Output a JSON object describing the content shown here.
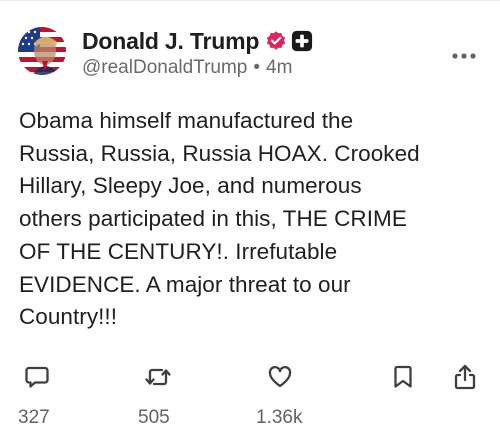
{
  "author": {
    "display_name": "Donald J. Trump",
    "handle": "@realDonaldTrump",
    "separator": "•",
    "timestamp": "4m",
    "avatar_icon": "flag-portrait-avatar",
    "verified_icon": "verified-badge-icon",
    "verified_color": "#e0245e",
    "government_icon": "government-badge-icon"
  },
  "post": {
    "text": "Obama himself manufactured the\nRussia, Russia, Russia HOAX. Crooked\nHillary, Sleepy Joe, and numerous\nothers participated in this, THE CRIME\nOF THE CENTURY!. Irrefutable\nEVIDENCE. A major threat to our\nCountry!!!"
  },
  "actions": {
    "reply": {
      "icon": "reply-icon",
      "count": "327"
    },
    "retruth": {
      "icon": "retruth-icon",
      "count": "505"
    },
    "like": {
      "icon": "heart-icon",
      "count": "1.36k"
    },
    "bookmark": {
      "icon": "bookmark-icon"
    },
    "share": {
      "icon": "share-icon"
    }
  },
  "menu": {
    "icon": "more-options-icon"
  }
}
